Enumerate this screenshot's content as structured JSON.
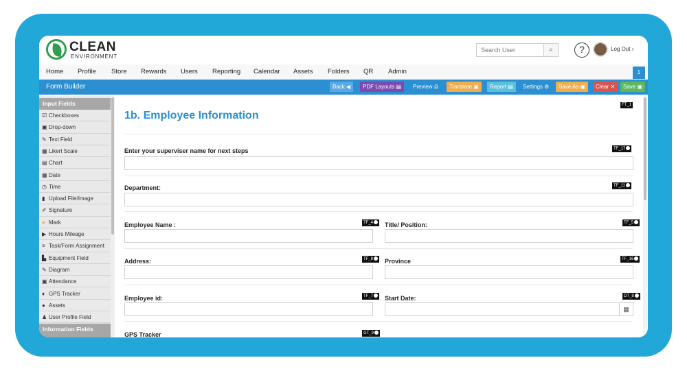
{
  "brand": {
    "name": "CLEAN",
    "sub": "ENVIRONMENT"
  },
  "header": {
    "search_placeholder": "Search User",
    "logout_label": "Log Out"
  },
  "menu": {
    "items": [
      "Home",
      "Profile",
      "Store",
      "Rewards",
      "Users",
      "Reporting",
      "Calendar",
      "Assets",
      "Folders",
      "QR",
      "Admin"
    ],
    "badge": "1"
  },
  "toolbar": {
    "title": "Form Builder",
    "back": "Back",
    "pdf_layouts": "PDF Layouts",
    "preview": "Preview",
    "translate": "Translate",
    "report": "Report",
    "settings": "Settings",
    "save_as": "Save As",
    "clear": "Clear",
    "save": "Save",
    "colors": {
      "back": "#5aa9e6",
      "pdf": "#7b4bb3",
      "preview": "#2b8fd1",
      "translate": "#f0ad4e",
      "report": "#5bc0de",
      "save_as": "#f0ad4e",
      "clear": "#d9534f",
      "save": "#5cb85c"
    }
  },
  "sidebar": {
    "input_header": "Input Fields",
    "items": [
      {
        "icon": "☑",
        "label": "Checkboxes"
      },
      {
        "icon": "▣",
        "label": "Drop-down"
      },
      {
        "icon": "✎",
        "label": "Text Field"
      },
      {
        "icon": "▦",
        "label": "Likert Scale"
      },
      {
        "icon": "▤",
        "label": "Chart"
      },
      {
        "icon": "▦",
        "label": "Date"
      },
      {
        "icon": "◷",
        "label": "Time"
      },
      {
        "icon": "▮",
        "label": "Upload File/Image"
      },
      {
        "icon": "✐",
        "label": "Signature"
      },
      {
        "icon": "●",
        "label": "Mark"
      },
      {
        "icon": "▶",
        "label": "Hours Mileage"
      },
      {
        "icon": "≡",
        "label": "Task/Form Assignment"
      },
      {
        "icon": "▙",
        "label": "Equipment Field"
      },
      {
        "icon": "✎",
        "label": "Diagram"
      },
      {
        "icon": "▣",
        "label": "Attendance"
      },
      {
        "icon": "♦",
        "label": "GPS Tracker"
      },
      {
        "icon": "●",
        "label": "Assets"
      },
      {
        "icon": "♟",
        "label": "User Profile Field"
      }
    ],
    "info_header": "Information Fields"
  },
  "form": {
    "ft_tag": "FT_1",
    "title": "1b. Employee Information",
    "fields": {
      "supervisor": {
        "label": "Enter your superviser name for next steps",
        "tag": "TF_17"
      },
      "department": {
        "label": "Department:",
        "tag": "TF_11"
      },
      "employee_name": {
        "label": "Employee Name :",
        "tag": "TF_4"
      },
      "title_position": {
        "label": "Title/ Position:",
        "tag": "TF_5"
      },
      "address": {
        "label": "Address:",
        "tag": "TF_8"
      },
      "province": {
        "label": "Province",
        "tag": "TF_16"
      },
      "employee_id": {
        "label": "Employee id:",
        "tag": "TF_7"
      },
      "start_date": {
        "label": "Start Date:",
        "tag": "DT_8"
      },
      "gps": {
        "label": "GPS Tracker",
        "tag": "GT_9"
      }
    }
  }
}
